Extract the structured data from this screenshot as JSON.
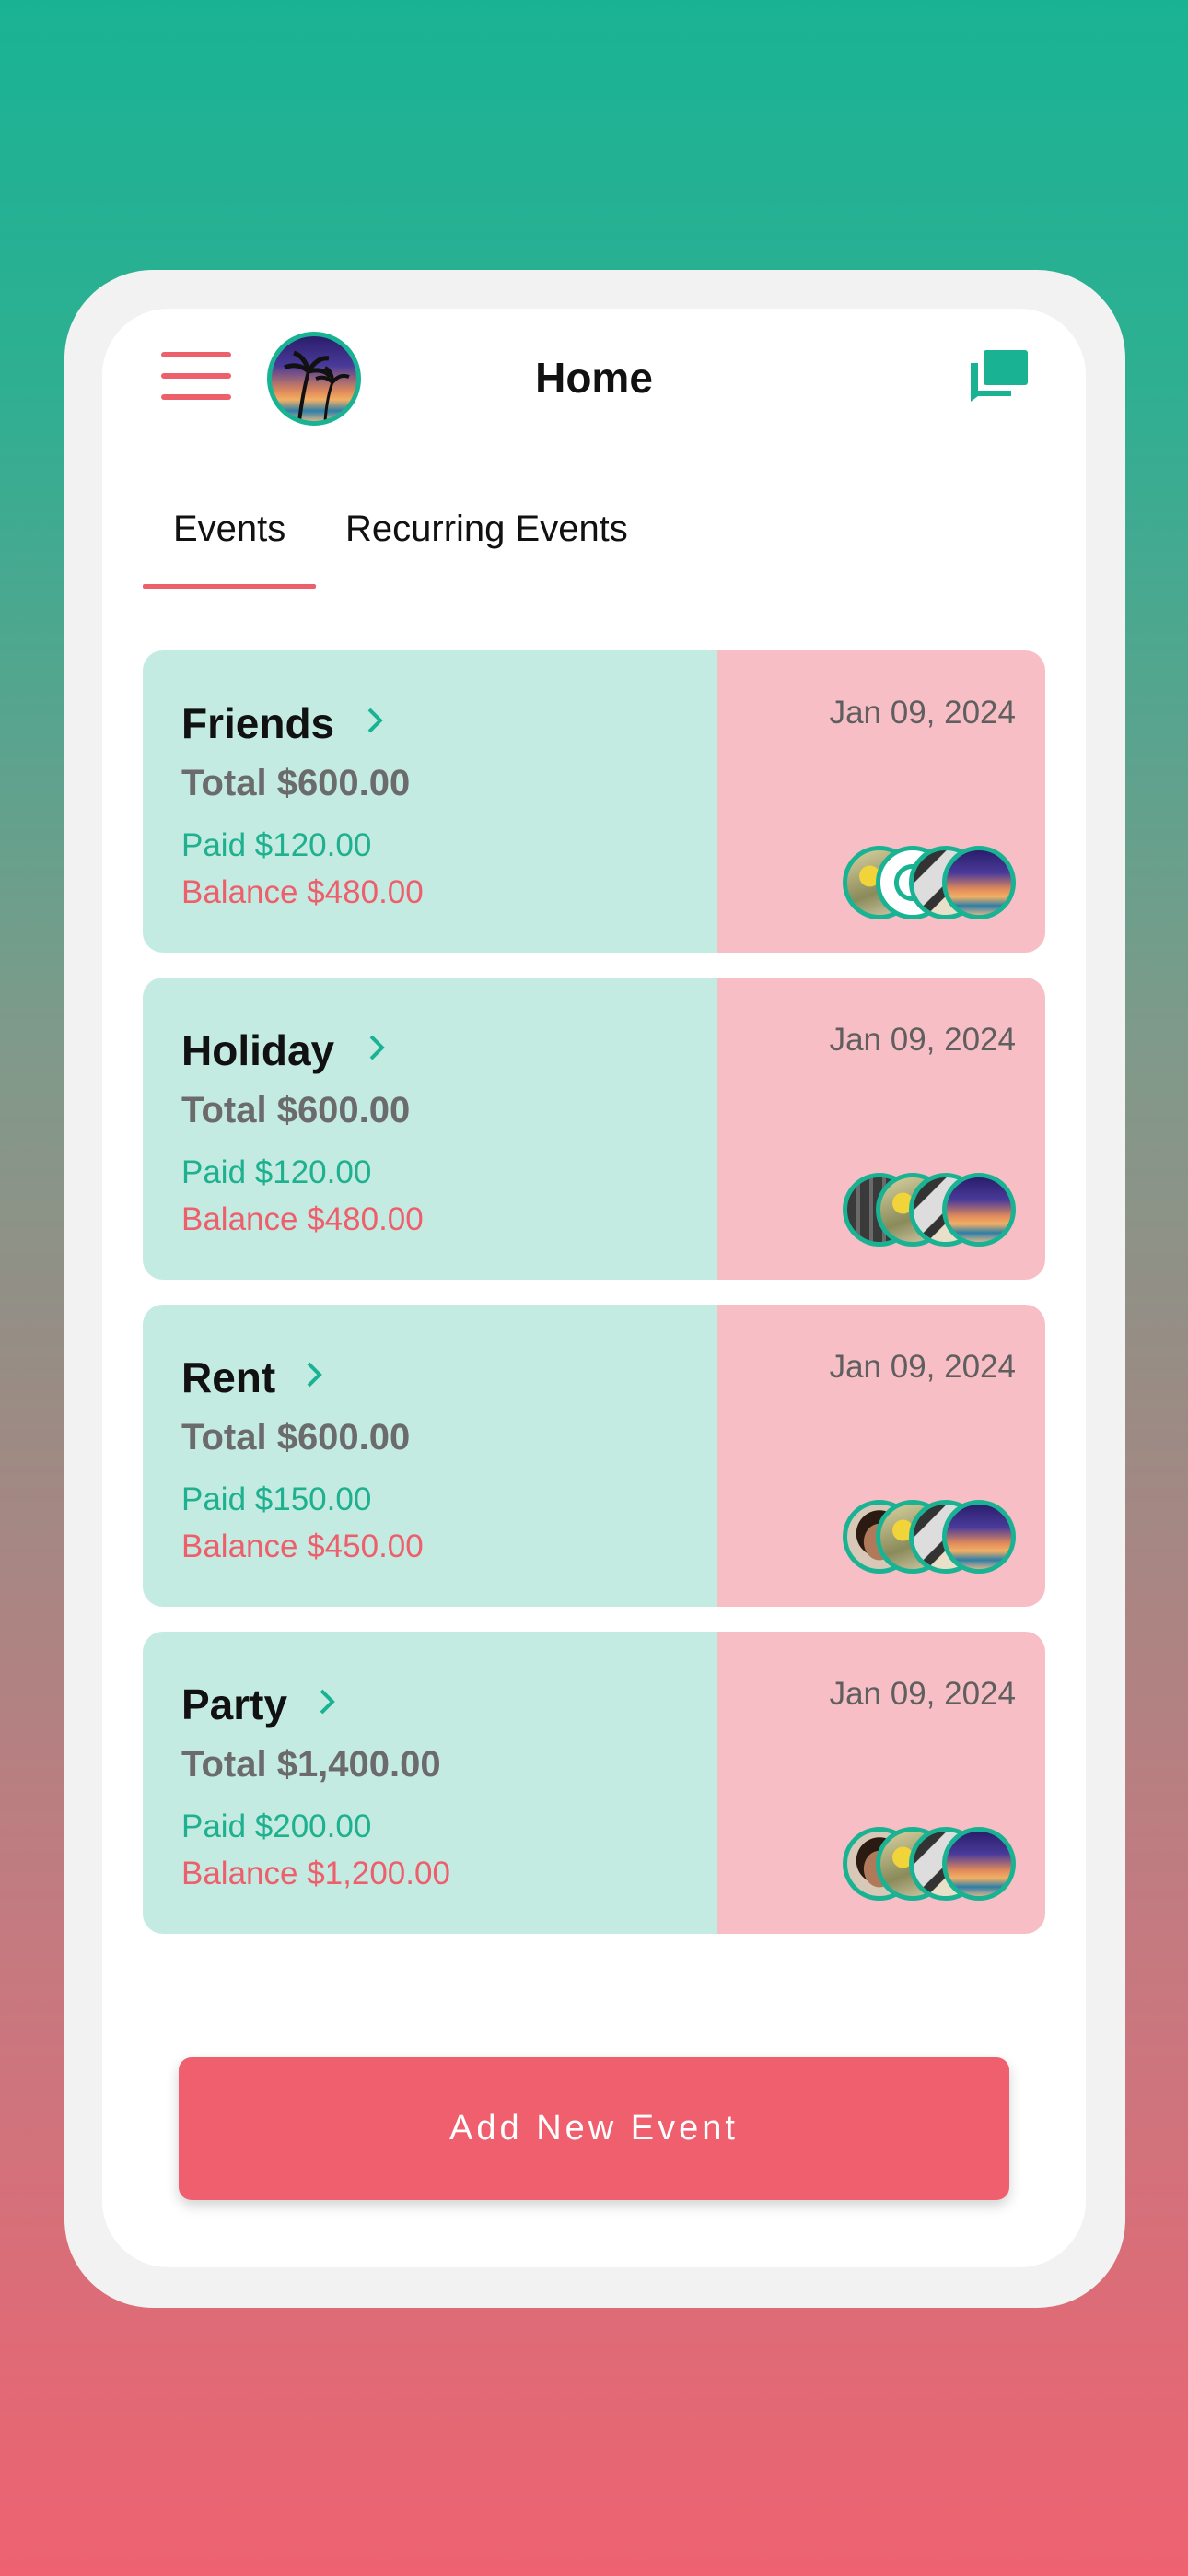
{
  "header": {
    "title": "Home",
    "menu_icon": "hamburger-menu-icon",
    "chat_icon": "chat-bubbles-icon",
    "avatar": "palm-tree-sunset-avatar"
  },
  "tabs": [
    {
      "label": "Events",
      "active": true
    },
    {
      "label": "Recurring Events",
      "active": false
    }
  ],
  "events": [
    {
      "name": "Friends",
      "date": "Jan 09, 2024",
      "total": "Total $600.00",
      "paid": "Paid $120.00",
      "balance": "Balance $480.00"
    },
    {
      "name": "Holiday",
      "date": "Jan 09, 2024",
      "total": "Total $600.00",
      "paid": "Paid $120.00",
      "balance": "Balance $480.00"
    },
    {
      "name": "Rent",
      "date": "Jan 09, 2024",
      "total": "Total $600.00",
      "paid": "Paid $150.00",
      "balance": "Balance $450.00"
    },
    {
      "name": "Party",
      "date": "Jan 09, 2024",
      "total": "Total $1,400.00",
      "paid": "Paid $200.00",
      "balance": "Balance $1,200.00"
    }
  ],
  "add_button": {
    "label": "Add New Event"
  },
  "colors": {
    "accent_teal": "#19b394",
    "accent_coral": "#f05f6d",
    "card_left": "#c4ebe2",
    "card_right": "#f8bec5"
  }
}
